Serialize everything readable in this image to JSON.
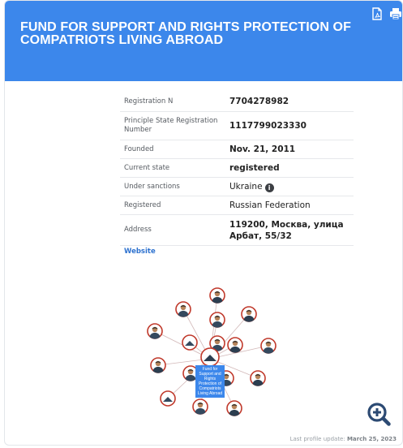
{
  "header": {
    "title": "Fund for Support and Rights Protection of Compatriots Living Abroad",
    "pdf_icon": "pdf-icon",
    "print_icon": "print-icon"
  },
  "fields": [
    {
      "label": "Registration N",
      "value": "7704278982"
    },
    {
      "label": "Principle State Registration Number",
      "value": "1117799023330"
    },
    {
      "label": "Founded",
      "value": "Nov. 21, 2011"
    },
    {
      "label": "Current state",
      "value": "registered"
    },
    {
      "label": "Under sanctions",
      "value": "Ukraine"
    },
    {
      "label": "Registered",
      "value": "Russian Federation"
    },
    {
      "label": "Address",
      "value": "119200, Москва, улица Арбат, 55/32"
    }
  ],
  "website_label": "Website",
  "graph": {
    "center_label": "Fund for Support and Rights Protection of Compatriots Living Abroad",
    "node_count": 16
  },
  "footer": {
    "update_prefix": "Last profile update:",
    "update_date": "March 25, 2023"
  },
  "colors": {
    "header": "#3c87eb",
    "link": "#2e72cf",
    "node_border": "#c0392b"
  }
}
